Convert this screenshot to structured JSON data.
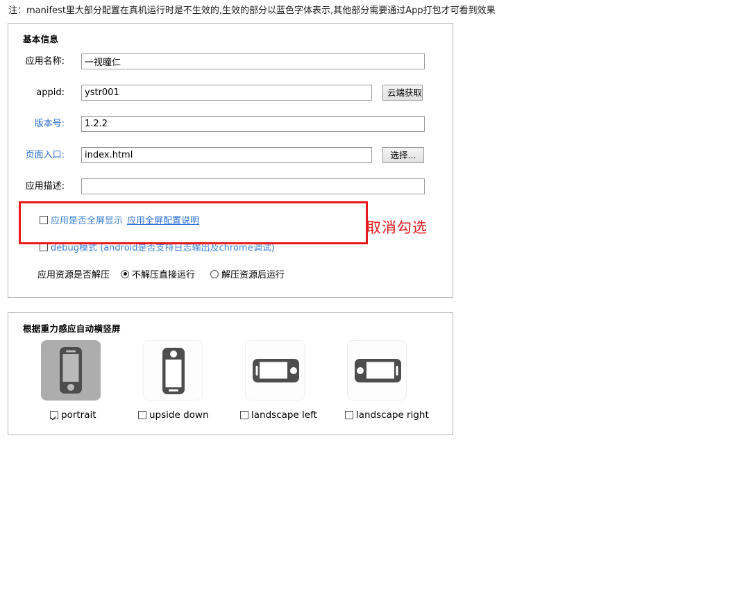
{
  "note": "注：manifest里大部分配置在真机运行时是不生效的,生效的部分以蓝色字体表示,其他部分需要通过App打包才可看到效果",
  "basic_panel": {
    "title": "基本信息",
    "fields": [
      {
        "label": "应用名称:",
        "value": "一视瞳仁",
        "label_color": "black",
        "button": null
      },
      {
        "label": "appid:",
        "value": "ystr001",
        "label_color": "black",
        "button": "云端获取"
      },
      {
        "label": "版本号:",
        "value": "1.2.2",
        "label_color": "blue",
        "button": null
      },
      {
        "label": "页面入口:",
        "value": "index.html",
        "label_color": "blue",
        "button": "选择..."
      },
      {
        "label": "应用描述:",
        "value": "",
        "label_color": "black",
        "button": null
      }
    ],
    "fullscreen": {
      "label": "应用是否全屏显示",
      "link": "应用全屏配置说明",
      "checked": false
    },
    "debug": {
      "label": "debug模式 (android是否支持日志输出及chrome调试)",
      "checked": false
    },
    "unzip": {
      "label": "应用资源是否解压",
      "options": [
        {
          "label": "不解压直接运行",
          "selected": true
        },
        {
          "label": "解压资源后运行",
          "selected": false
        }
      ]
    }
  },
  "annotation": {
    "text": "取消勾选",
    "color": "#e8191b"
  },
  "orientation_panel": {
    "title": "根据重力感应自动横竖屏",
    "items": [
      {
        "label": "portrait",
        "checked": true,
        "icon": "phone-portrait-icon",
        "selected": true
      },
      {
        "label": "upside down",
        "checked": false,
        "icon": "phone-upside-down-icon",
        "selected": false
      },
      {
        "label": "landscape left",
        "checked": false,
        "icon": "phone-landscape-left-icon",
        "selected": false
      },
      {
        "label": "landscape right",
        "checked": false,
        "icon": "phone-landscape-right-icon",
        "selected": false
      }
    ]
  }
}
